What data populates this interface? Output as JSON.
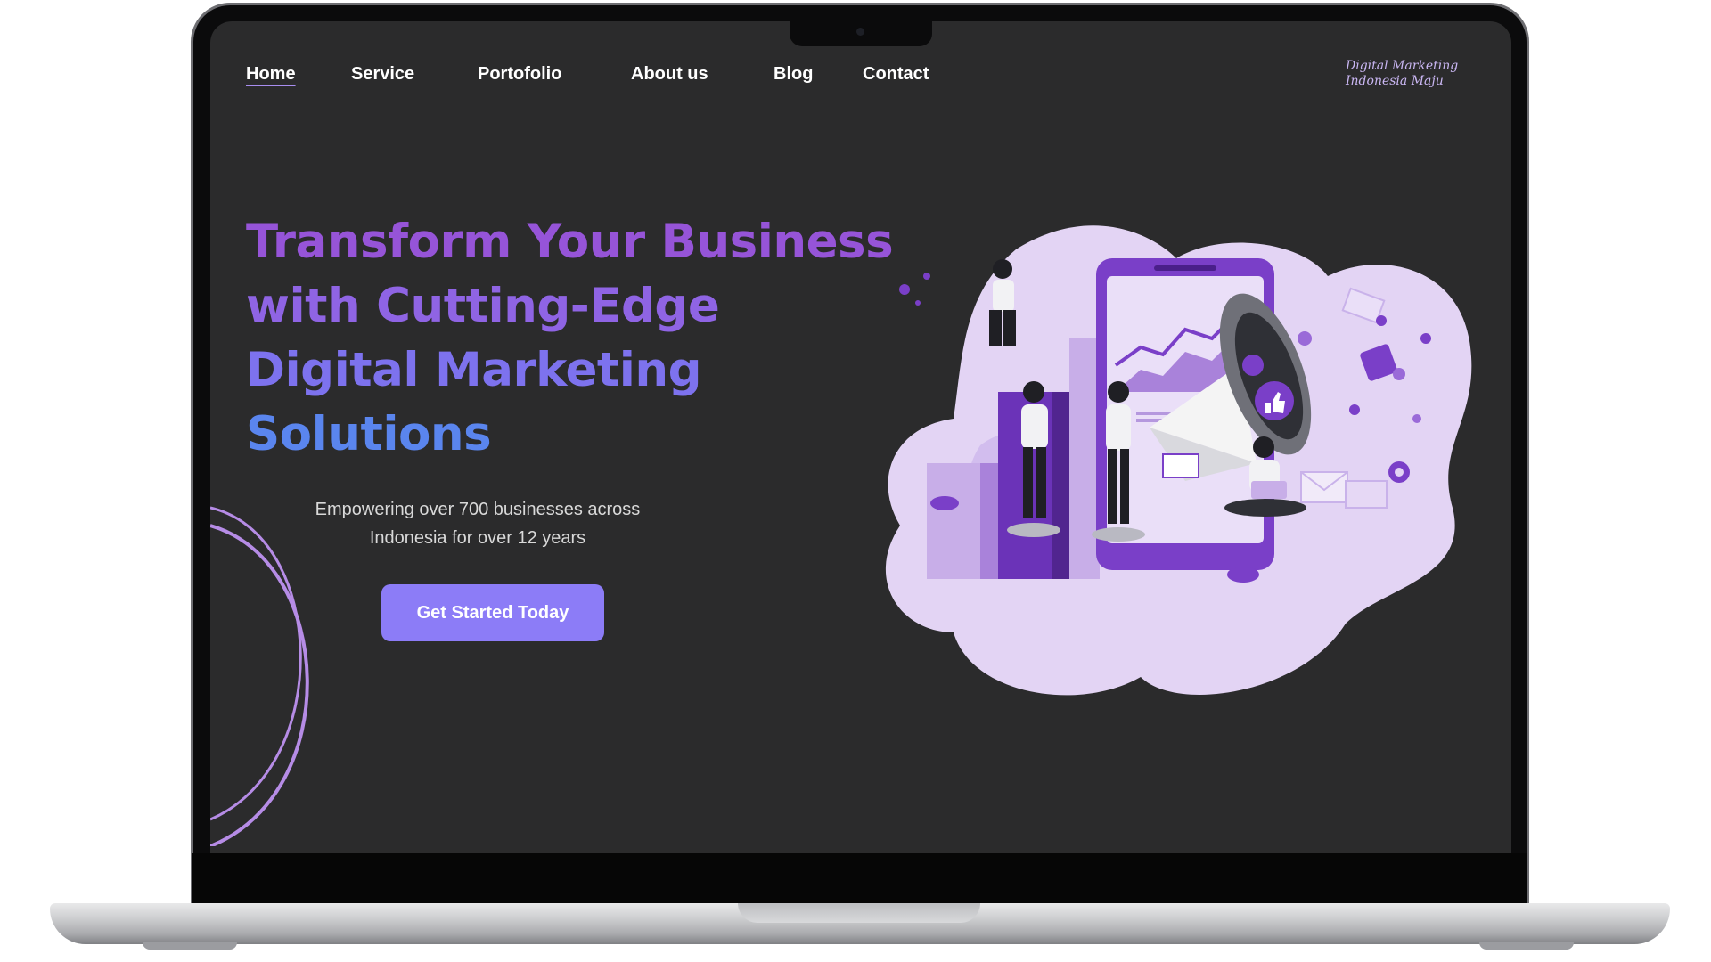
{
  "nav": {
    "items": [
      "Home",
      "Service",
      "Portofolio",
      "About us",
      "Blog",
      "Contact"
    ],
    "active": "Home"
  },
  "brand": {
    "line1": "Digital Marketing",
    "line2": "Indonesia Maju"
  },
  "hero": {
    "title_lines": [
      "Transform Your Business",
      "with Cutting-Edge",
      "Digital Marketing",
      "Solutions"
    ],
    "title_colors": [
      "#9654d8",
      "#8f64e4",
      "#7d72ee",
      "#5a85ee"
    ],
    "subtext_line1": "Empowering over 700 businesses across",
    "subtext_line2": "Indonesia for over 12 years",
    "cta_label": "Get Started Today"
  },
  "colors": {
    "background": "#2b2b2c",
    "accent": "#8c7cf7",
    "illustration_primary": "#7a3fc8",
    "illustration_light": "#e3d4f4"
  },
  "icons": [
    "megaphone-icon",
    "thumbs-up-icon",
    "phone-icon",
    "bar-chart-icon",
    "envelope-icon",
    "gear-icon"
  ]
}
